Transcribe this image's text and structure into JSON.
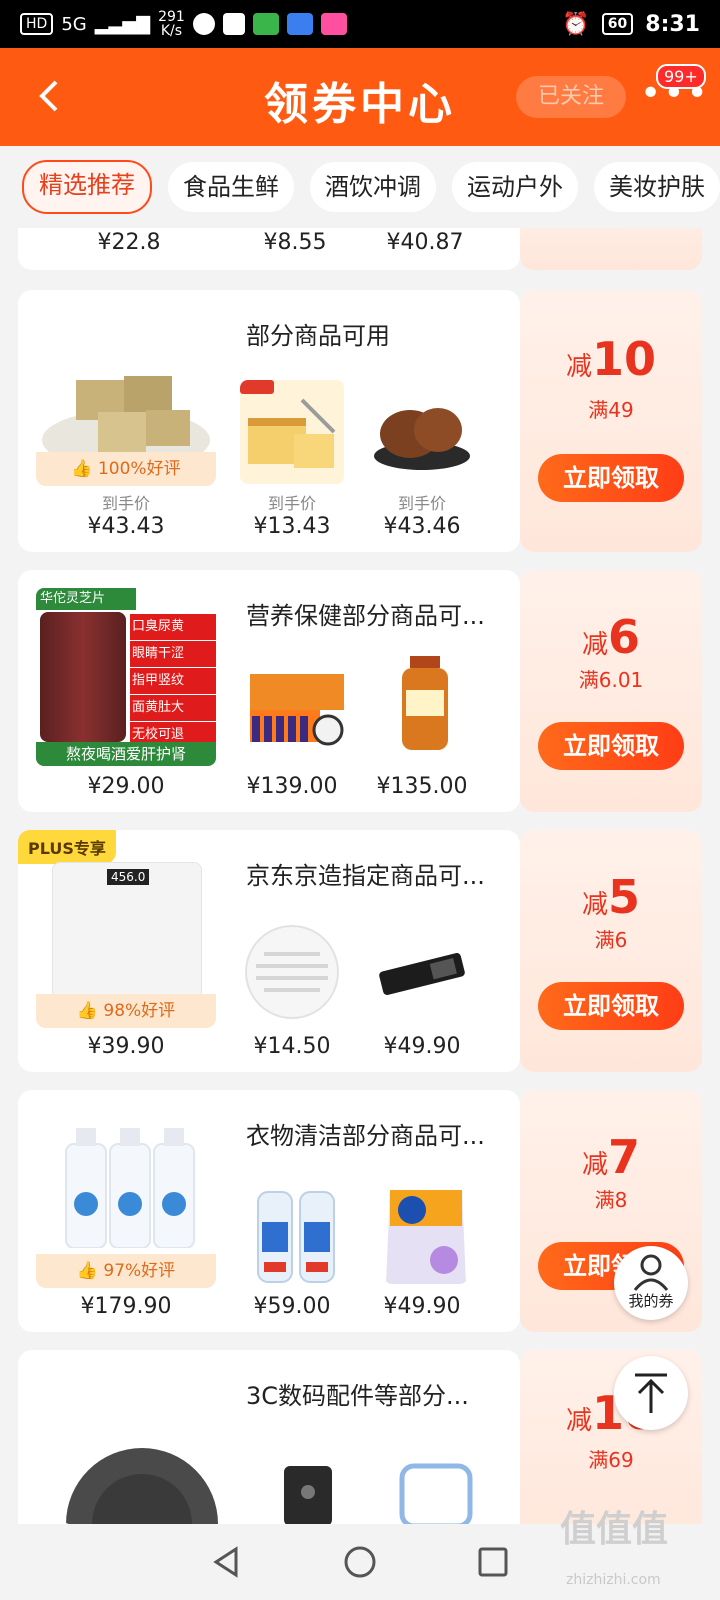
{
  "status": {
    "signal": "5G",
    "speed_value": "291",
    "speed_unit": "K/s",
    "battery": "60",
    "time": "8:31"
  },
  "header": {
    "title": "领券中心",
    "follow": "已关注",
    "badge": "99+"
  },
  "tabs": [
    "精选推荐",
    "食品生鲜",
    "酒饮冲调",
    "运动户外",
    "美妆护肤"
  ],
  "partial_prices": [
    "¥22.8",
    "¥8.55",
    "¥40.87"
  ],
  "coupons": [
    {
      "scope": "部分商品可用",
      "reduce": "10",
      "min": "满49",
      "rating": "100%好评",
      "daoshou": "到手价",
      "prices": [
        "¥43.43",
        "¥13.43",
        "¥43.46"
      ]
    },
    {
      "scope": "营养保健部分商品可...",
      "reduce": "6",
      "min": "满6.01",
      "prices": [
        "¥29.00",
        "¥139.00",
        "¥135.00"
      ],
      "ad": {
        "brand": "华佗灵芝片",
        "lines": [
          "口臭尿黄",
          "眼睛干涩",
          "指甲竖纹",
          "面黄肚大",
          "无校可退"
        ],
        "bottom": "熬夜喝酒爱肝护肾"
      }
    },
    {
      "scope": "京东京造指定商品可...",
      "reduce": "5",
      "min": "满6",
      "rating": "98%好评",
      "plus": "PLUS专享",
      "scale_display": "456.0",
      "prices": [
        "¥39.90",
        "¥14.50",
        "¥49.90"
      ]
    },
    {
      "scope": "衣物清洁部分商品可...",
      "reduce": "7",
      "min": "满8",
      "rating": "97%好评",
      "prices": [
        "¥179.90",
        "¥59.00",
        "¥49.90"
      ]
    },
    {
      "scope": "3C数码配件等部分...",
      "reduce": "10",
      "min": "满69"
    }
  ],
  "labels": {
    "reduce_prefix": "减",
    "claim": "立即领取",
    "my_coupons": "我的券"
  },
  "watermark": {
    "main": "值值值",
    "sub": "zhizhizhi.com"
  }
}
